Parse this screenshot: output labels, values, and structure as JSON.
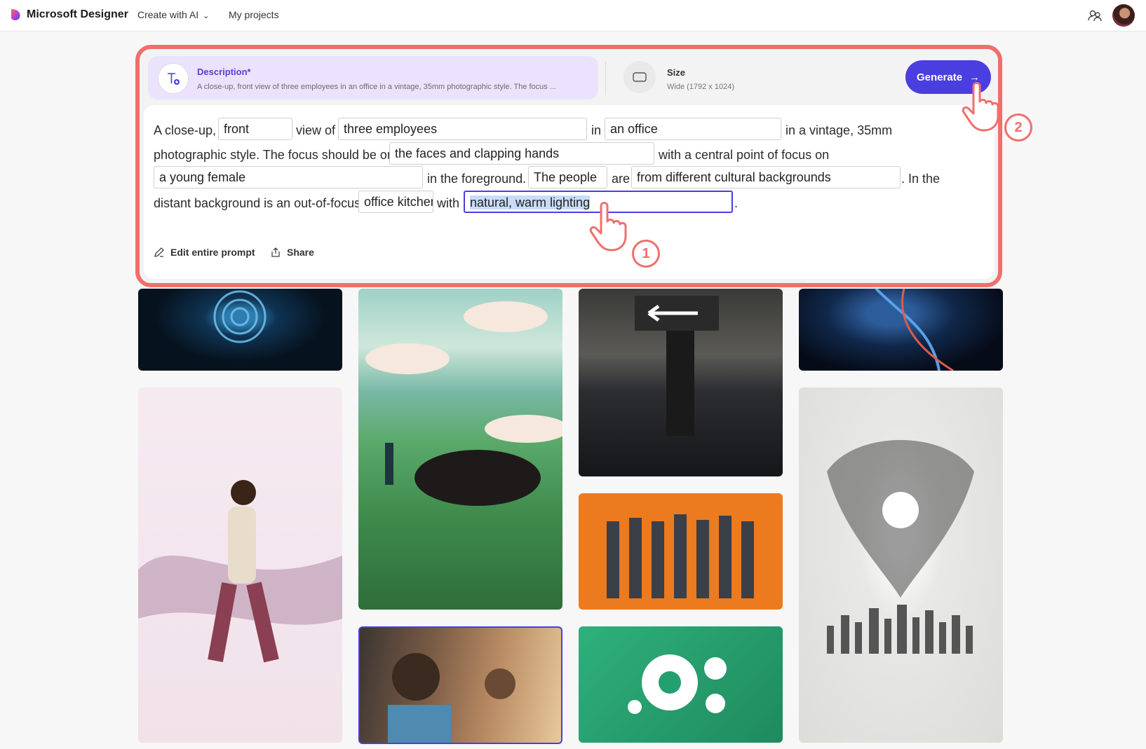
{
  "app": {
    "brand": "Microsoft Designer",
    "nav": [
      {
        "label": "Create with AI"
      },
      {
        "label": "My projects"
      }
    ]
  },
  "prompt_card": {
    "description_label": "Description*",
    "description_preview": "A close-up, front view of three employees in an office in a vintage, 35mm photographic style. The focus ...",
    "size_label": "Size",
    "size_value": "Wide (1792 x 1024)",
    "generate_label": "Generate",
    "text": {
      "t1": "A close-up,",
      "t2": "view of",
      "t3": "in",
      "t4": "in a vintage, 35mm",
      "t5": "photographic style. The focus should be on",
      "t6": "with a central point of focus on",
      "t7": "in the foreground.",
      "t8": "are",
      "t9": ". In the",
      "t10": "distant background is an out-of-focus",
      "t11": "with",
      "t12": "."
    },
    "slots": {
      "s1": "front",
      "s2": "three employees",
      "s3": "an office",
      "s4": "the faces and clapping hands",
      "s5": "a young female",
      "s6": "The people",
      "s7": "from different cultural backgrounds",
      "s8": "office kitchen",
      "s9": "natural, warm lighting"
    },
    "edit_prompt_label": "Edit entire prompt",
    "share_label": "Share"
  },
  "annotations": {
    "step1": "1",
    "step2": "2"
  },
  "colors": {
    "accent": "#4a3ee0",
    "highlight_outline": "#ef6f6c",
    "description_bg": "#ebe3fd"
  },
  "icons": [
    "designer-logo-icon",
    "chevron-down-icon",
    "people-share-icon",
    "text-add-icon",
    "aspect-ratio-icon",
    "arrow-right-icon",
    "pen-sparkle-icon",
    "share-icon",
    "hand-pointer-icon"
  ]
}
